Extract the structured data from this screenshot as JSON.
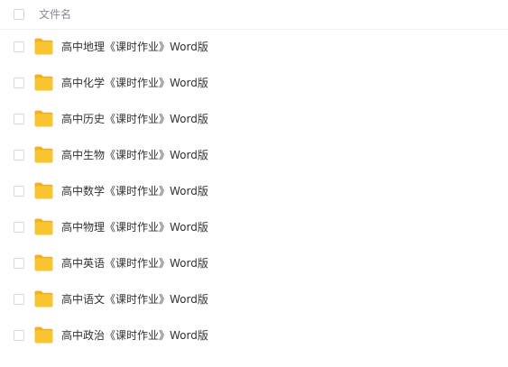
{
  "header": {
    "name_column_label": "文件名"
  },
  "folder_color": "#f9c531",
  "folder_tab_color": "#f3b11f",
  "files": [
    {
      "name": "高中地理《课时作业》Word版",
      "type": "folder",
      "icon": "folder-icon"
    },
    {
      "name": "高中化学《课时作业》Word版",
      "type": "folder",
      "icon": "folder-icon"
    },
    {
      "name": "高中历史《课时作业》Word版",
      "type": "folder",
      "icon": "folder-icon"
    },
    {
      "name": "高中生物《课时作业》Word版",
      "type": "folder",
      "icon": "folder-icon"
    },
    {
      "name": "高中数学《课时作业》Word版",
      "type": "folder",
      "icon": "folder-icon"
    },
    {
      "name": "高中物理《课时作业》Word版",
      "type": "folder",
      "icon": "folder-icon"
    },
    {
      "name": "高中英语《课时作业》Word版",
      "type": "folder",
      "icon": "folder-icon"
    },
    {
      "name": "高中语文《课时作业》Word版",
      "type": "folder",
      "icon": "folder-icon"
    },
    {
      "name": "高中政治《课时作业》Word版",
      "type": "folder",
      "icon": "folder-icon"
    }
  ]
}
